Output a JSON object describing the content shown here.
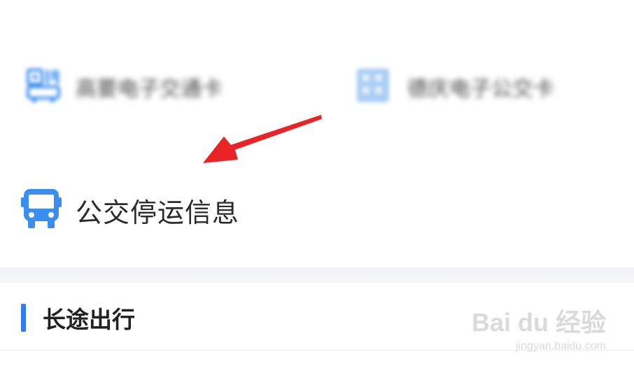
{
  "services": {
    "item1": {
      "label": "高要电子交通卡",
      "icon": "qr-bus-card-icon"
    },
    "item2": {
      "label": "德庆电子公交卡",
      "icon": "grid-card-icon"
    },
    "item3": {
      "label": "公交停运信息",
      "icon": "bus-icon"
    }
  },
  "section": {
    "title": "长途出行"
  },
  "watermark": {
    "brand": "Bai du 经验",
    "url": "jingyan.baidu.com"
  },
  "colors": {
    "accent": "#2f7cf6",
    "icon_blue": "#3a8ef0",
    "arrow_red": "#e8262a"
  }
}
